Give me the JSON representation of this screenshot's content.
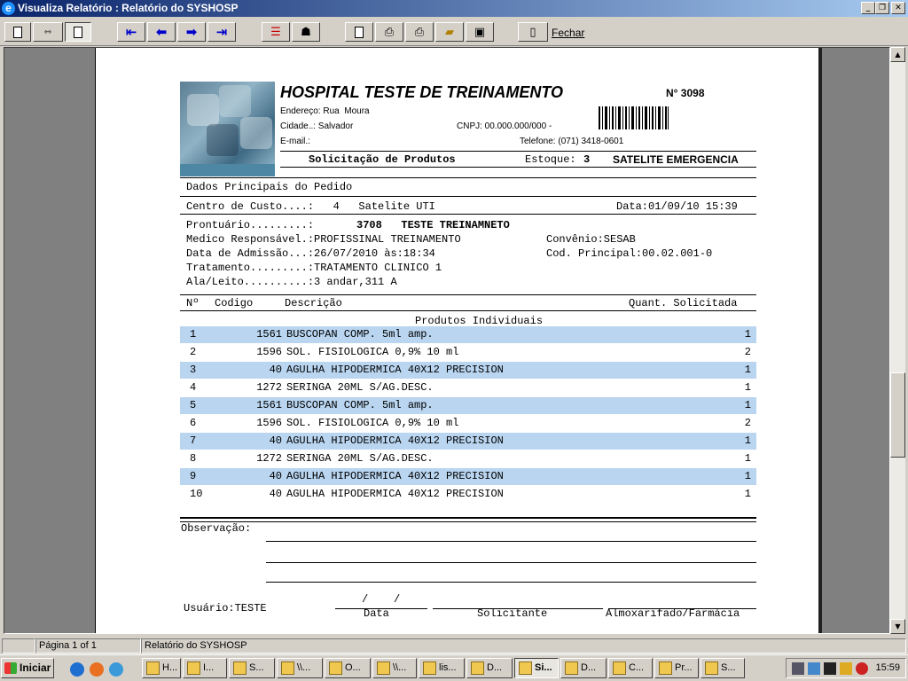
{
  "window": {
    "title": "Visualiza Relatório : Relatório do SYSHOSP",
    "app_icon": "e"
  },
  "toolbar": {
    "close_label": "Fechar"
  },
  "report": {
    "hospital_name": "HOSPITAL TESTE DE TREINAMENTO",
    "number": "N° 3098",
    "address": "Endereço: Rua  Moura",
    "city": "Cidade..: Salvador",
    "cnpj": "CNPJ: 00.000.000/000 -",
    "email": "E-mail.:",
    "phone": "Telefone: (071) 3418-0601",
    "form_title": "Solicitação de Produtos",
    "stock_label": "Estoque:",
    "stock_value": "3",
    "stock_name": "SATELITE EMERGENCIA",
    "section_title": "Dados Principais do Pedido",
    "cost_center": "Centro de Custo....:   4   Satelite UTI",
    "date": "Data:01/09/10 15:39",
    "record_label": "Prontuário.........:",
    "record_value": "3708   TESTE TREINAMNETO",
    "doctor": "Medico Responsável.:PROFISSINAL TREINAMENTO",
    "agreement": "Convênio:SESAB",
    "admission": "Data de Admissão...:26/07/2010 às:18:34",
    "main_code": "Cod. Principal:00.02.001-0",
    "treatment": "Tratamento.........:TRATAMENTO CLINICO 1",
    "bed": "Ala/Leito..........:3 andar,311 A",
    "col_no": "Nº",
    "col_code": "Codigo",
    "col_desc": "Descrição",
    "col_qty": "Quant. Solicitada",
    "group_title": "Produtos Individuais",
    "items": [
      {
        "n": "1",
        "code": "1561",
        "desc": "BUSCOPAN COMP. 5ml amp.",
        "qty": "1",
        "hl": true
      },
      {
        "n": "2",
        "code": "1596",
        "desc": "SOL. FISIOLOGICA 0,9% 10 ml",
        "qty": "2",
        "hl": false
      },
      {
        "n": "3",
        "code": "40",
        "desc": "AGULHA HIPODERMICA 40X12 PRECISION",
        "qty": "1",
        "hl": true
      },
      {
        "n": "4",
        "code": "1272",
        "desc": "SERINGA 20ML S/AG.DESC.",
        "qty": "1",
        "hl": false
      },
      {
        "n": "5",
        "code": "1561",
        "desc": "BUSCOPAN COMP. 5ml amp.",
        "qty": "1",
        "hl": true
      },
      {
        "n": "6",
        "code": "1596",
        "desc": "SOL. FISIOLOGICA 0,9% 10 ml",
        "qty": "2",
        "hl": false
      },
      {
        "n": "7",
        "code": "40",
        "desc": "AGULHA HIPODERMICA 40X12 PRECISION",
        "qty": "1",
        "hl": true
      },
      {
        "n": "8",
        "code": "1272",
        "desc": "SERINGA 20ML S/AG.DESC.",
        "qty": "1",
        "hl": false
      },
      {
        "n": "9",
        "code": "40",
        "desc": "AGULHA HIPODERMICA 40X12 PRECISION",
        "qty": "1",
        "hl": true
      },
      {
        "n": "10",
        "code": "40",
        "desc": "AGULHA HIPODERMICA 40X12 PRECISION",
        "qty": "1",
        "hl": false
      }
    ],
    "observation_label": "Observação:",
    "user": "Usuário:TESTE",
    "date_slashes": "/    /",
    "sig_date": "Data",
    "sig_requester": "Solicitante",
    "sig_pharmacy": "Almoxarifado/Farmácia"
  },
  "status": {
    "page": "Página 1 of 1",
    "report_name": "Relatório do SYSHOSP"
  },
  "taskbar": {
    "start_label": "Iniciar",
    "tasks": [
      "H...",
      "I...",
      "S...",
      "\\\\...",
      "O...",
      "\\\\...",
      "lis...",
      "D...",
      "Si...",
      "D...",
      "C...",
      "Pr...",
      "S..."
    ],
    "clock": "15:59"
  },
  "colors": {
    "row_highlight": "#b9d5f0",
    "titlebar_start": "#0a246a",
    "nav_arrow": "#0000cc"
  }
}
